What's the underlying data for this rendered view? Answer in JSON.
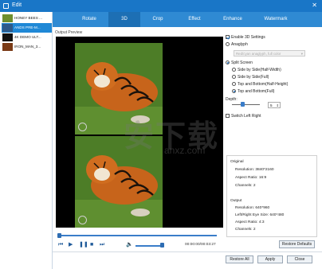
{
  "window": {
    "title": "Edit",
    "close_glyph": "✕"
  },
  "files": [
    {
      "name": "HONEY BEES ...",
      "selected": false,
      "thumb_color": "#6f8f2e"
    },
    {
      "name": "ANDS PRE-M...",
      "selected": true,
      "thumb_color": "#2e5a8a"
    },
    {
      "name": "4K DEMO ULT...",
      "selected": false,
      "thumb_color": "#111111"
    },
    {
      "name": "IRON_MAN_3...",
      "selected": false,
      "thumb_color": "#7a3b17"
    }
  ],
  "tabs": [
    "Rotate",
    "3D",
    "Crop",
    "Effect",
    "Enhance",
    "Watermark"
  ],
  "active_tab": "3D",
  "preview": {
    "label": "Output Preview"
  },
  "settings": {
    "enable_3d_label": "Enable 3D Settings",
    "enable_3d_checked": true,
    "anaglyph_label": "Anaglyph",
    "anaglyph_select": "Red/cyan anaglyph, full color",
    "split_screen_label": "Split Screen",
    "split_options": [
      {
        "label": "Side by Side(Half-Width)",
        "checked": false
      },
      {
        "label": "Side by Side(Full)",
        "checked": false
      },
      {
        "label": "Top and Bottom(Half-Height)",
        "checked": false
      },
      {
        "label": "Top and Bottom(Full)",
        "checked": true
      }
    ],
    "depth_label": "Depth:",
    "depth_value": "5",
    "switch_label": "Switch Left Right",
    "switch_checked": false
  },
  "info": {
    "original_header": "Original",
    "original_resolution": "Resolution: 3840*2160",
    "original_aspect": "Aspect Ratio: 16:9",
    "original_channels": "Channels: 2",
    "output_header": "Output",
    "output_resolution": "Resolution: 640*960",
    "output_eye_size": "Left/Right Eye Size: 640*480",
    "output_aspect": "Aspect Ratio: 4:3",
    "output_channels": "Channels: 2",
    "restore_defaults": "Restore Defaults"
  },
  "player": {
    "time": "00:00:00/00:03:27",
    "progress": 0.01,
    "volume": 0.9
  },
  "buttons": {
    "restore_all": "Restore All",
    "apply": "Apply",
    "close": "Close"
  },
  "watermark": {
    "text": "安下载",
    "url": "anxz.com"
  },
  "colors": {
    "titlebar": "#1976c7",
    "tabs": "#2f8ad3",
    "tab_active": "#1d6fb4",
    "accent": "#3a7dc9"
  }
}
